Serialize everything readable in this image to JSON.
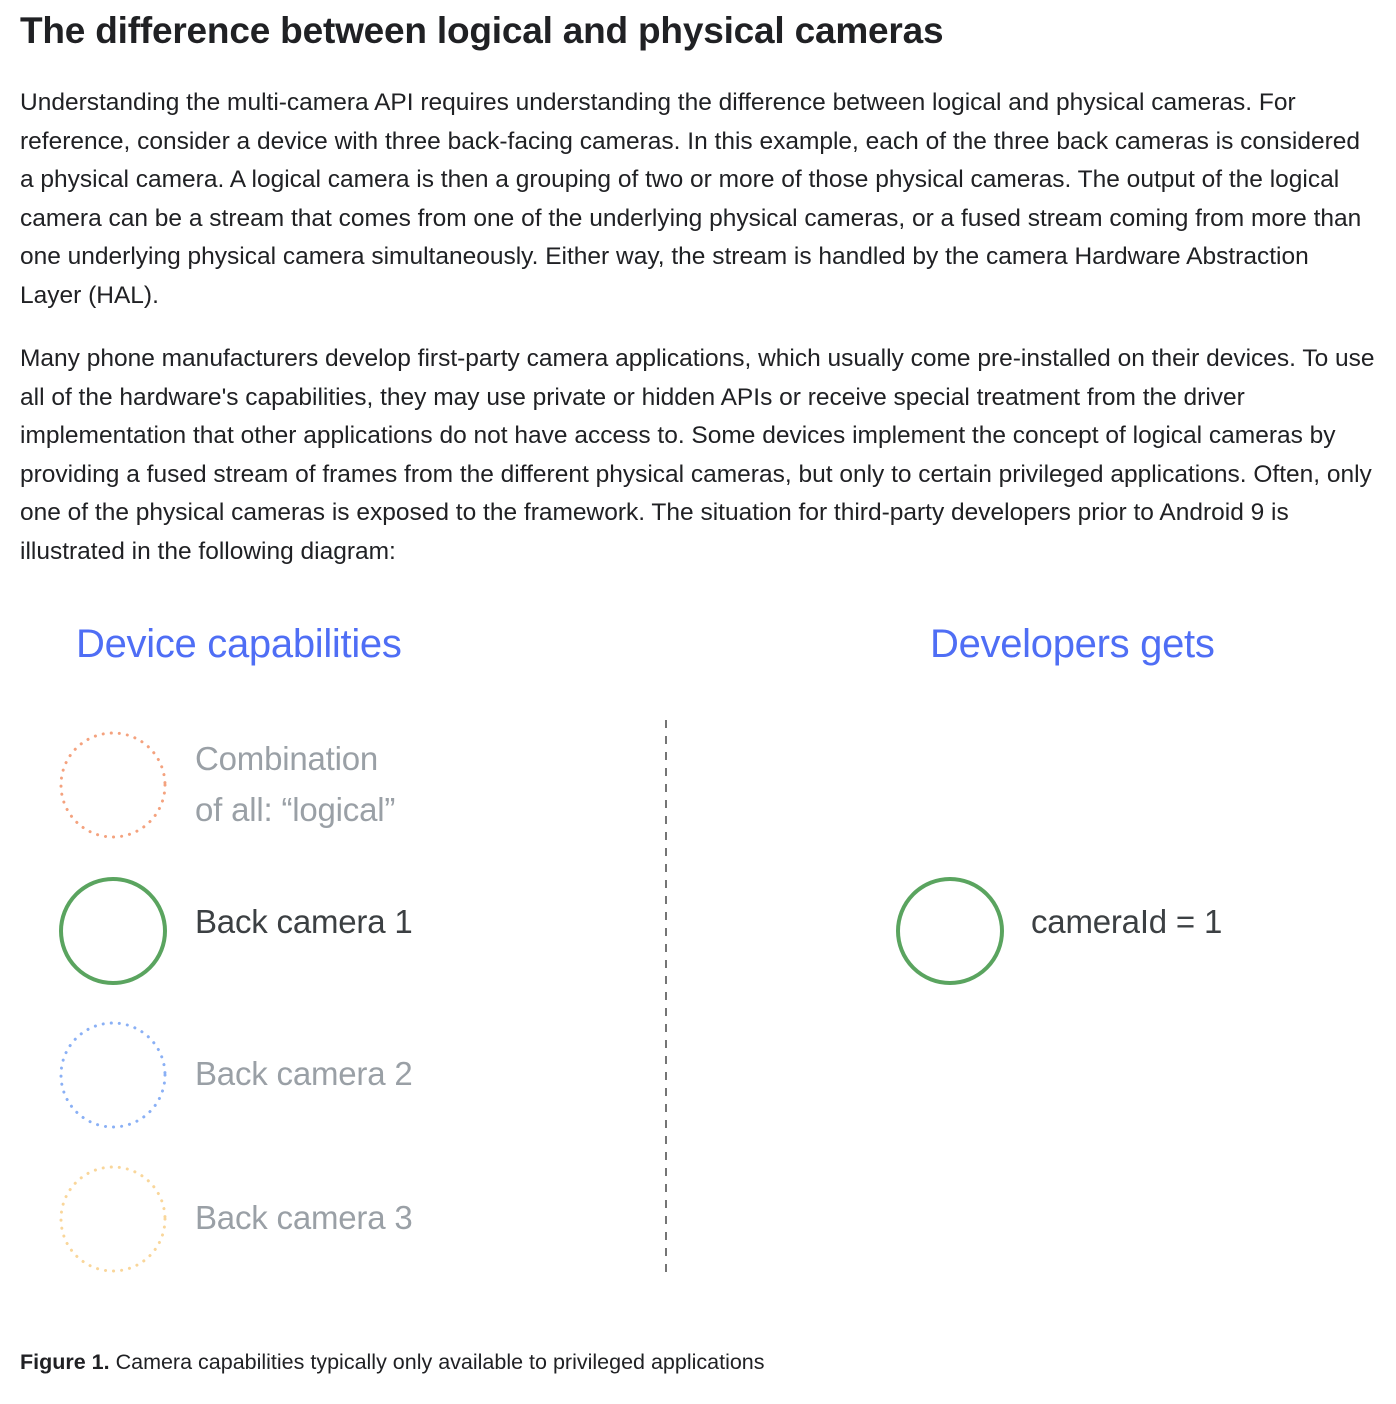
{
  "section": {
    "title": "The difference between logical and physical cameras"
  },
  "paragraphs": [
    "Understanding the multi-camera API requires understanding the difference between logical and physical cameras. For reference, consider a device with three back-facing cameras. In this example, each of the three back cameras is considered a physical camera. A logical camera is then a grouping of two or more of those physical cameras. The output of the logical camera can be a stream that comes from one of the underlying physical cameras, or a fused stream coming from more than one underlying physical camera simultaneously. Either way, the stream is handled by the camera Hardware Abstraction Layer (HAL).",
    "Many phone manufacturers develop first-party camera applications, which usually come pre-installed on their devices. To use all of the hardware's capabilities, they may use private or hidden APIs or receive special treatment from the driver implementation that other applications do not have access to. Some devices implement the concept of logical cameras by providing a fused stream of frames from the different physical cameras, but only to certain privileged applications. Often, only one of the physical cameras is exposed to the framework. The situation for third-party developers prior to Android 9 is illustrated in the following diagram:"
  ],
  "diagram": {
    "left_heading": "Device capabilities",
    "right_heading": "Developers gets",
    "left_items": [
      {
        "label_line1": "Combination",
        "label_line2": "of all: “logical”",
        "color": "#f4a27e",
        "style": "dotted"
      },
      {
        "label": "Back camera 1",
        "color": "#5aa45f",
        "style": "solid"
      },
      {
        "label": "Back camera 2",
        "color": "#8ab0f5",
        "style": "dotted"
      },
      {
        "label": "Back camera 3",
        "color": "#f9d69a",
        "style": "dotted"
      }
    ],
    "right_items": [
      {
        "label": "cameraId = 1",
        "color": "#5aa45f",
        "style": "solid"
      }
    ],
    "heading_color": "#4f6ef5",
    "divider_color": "#757575"
  },
  "caption": {
    "figure_label": "Figure 1.",
    "text": " Camera capabilities typically only available to privileged applications"
  }
}
